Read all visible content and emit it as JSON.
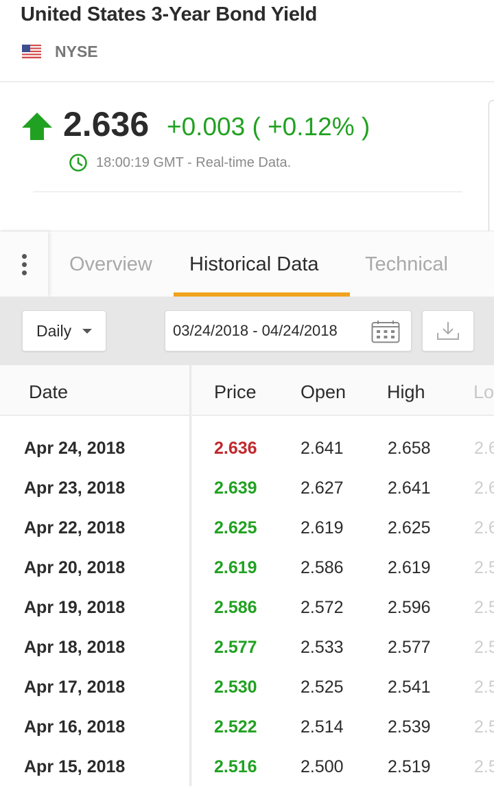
{
  "header": {
    "title": "United States 3-Year Bond Yield",
    "exchange": "NYSE",
    "flag_icon": "us-flag-icon"
  },
  "quote": {
    "price": "2.636",
    "change": "+0.003 ( +0.12% )",
    "time": "18:00:19 GMT - Real-time Data.",
    "direction_icon": "arrow-up-icon",
    "up_color": "#21a121"
  },
  "tabs": {
    "items": [
      {
        "label": "Overview",
        "active": false
      },
      {
        "label": "Historical Data",
        "active": true
      },
      {
        "label": "Technical",
        "active": false
      }
    ],
    "active_color": "#f0a31c"
  },
  "filters": {
    "interval": "Daily",
    "date_range": "03/24/2018 - 04/24/2018"
  },
  "table": {
    "columns": [
      "Date",
      "Price",
      "Open",
      "High",
      "Lo"
    ],
    "rows": [
      {
        "date": "Apr 24, 2018",
        "price": "2.636",
        "open": "2.641",
        "high": "2.658",
        "low": "2.6",
        "trend": "down"
      },
      {
        "date": "Apr 23, 2018",
        "price": "2.639",
        "open": "2.627",
        "high": "2.641",
        "low": "2.6",
        "trend": "up"
      },
      {
        "date": "Apr 22, 2018",
        "price": "2.625",
        "open": "2.619",
        "high": "2.625",
        "low": "2.6",
        "trend": "up"
      },
      {
        "date": "Apr 20, 2018",
        "price": "2.619",
        "open": "2.586",
        "high": "2.619",
        "low": "2.5",
        "trend": "up"
      },
      {
        "date": "Apr 19, 2018",
        "price": "2.586",
        "open": "2.572",
        "high": "2.596",
        "low": "2.5",
        "trend": "up"
      },
      {
        "date": "Apr 18, 2018",
        "price": "2.577",
        "open": "2.533",
        "high": "2.577",
        "low": "2.5",
        "trend": "up"
      },
      {
        "date": "Apr 17, 2018",
        "price": "2.530",
        "open": "2.525",
        "high": "2.541",
        "low": "2.5",
        "trend": "up"
      },
      {
        "date": "Apr 16, 2018",
        "price": "2.522",
        "open": "2.514",
        "high": "2.539",
        "low": "2.5",
        "trend": "up"
      },
      {
        "date": "Apr 15, 2018",
        "price": "2.516",
        "open": "2.500",
        "high": "2.519",
        "low": "2.5",
        "trend": "up"
      }
    ]
  }
}
